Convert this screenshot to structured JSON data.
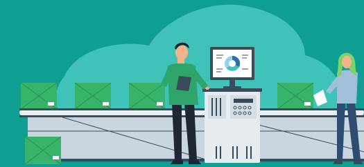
{
  "scene": {
    "description_free": true,
    "colors": {
      "background": "#0f9e92",
      "blob": "#3fc3b8",
      "belt_top": "#e9eef2",
      "belt_side": "#c9d6df",
      "belt_edge": "#384b5a",
      "box": "#38b36a",
      "box_dark": "#2c9757",
      "label": "#ffffff",
      "machine_body": "#e6ebef",
      "machine_panel": "#d4dde3",
      "shirt_green": "#2ea66b",
      "shirt_blue": "#9fc0d8",
      "pants": "#1e2733",
      "jeans": "#2e4b72",
      "skin": "#f2b48a",
      "hair_dark": "#1c2530",
      "hair_green": "#7fd16a",
      "monitor_frame": "#3c4c5a",
      "screen": "#ffffff",
      "donut_a": "#2f6fa8",
      "donut_b": "#3fc3b8",
      "donut_c": "#8fd3ee"
    }
  }
}
